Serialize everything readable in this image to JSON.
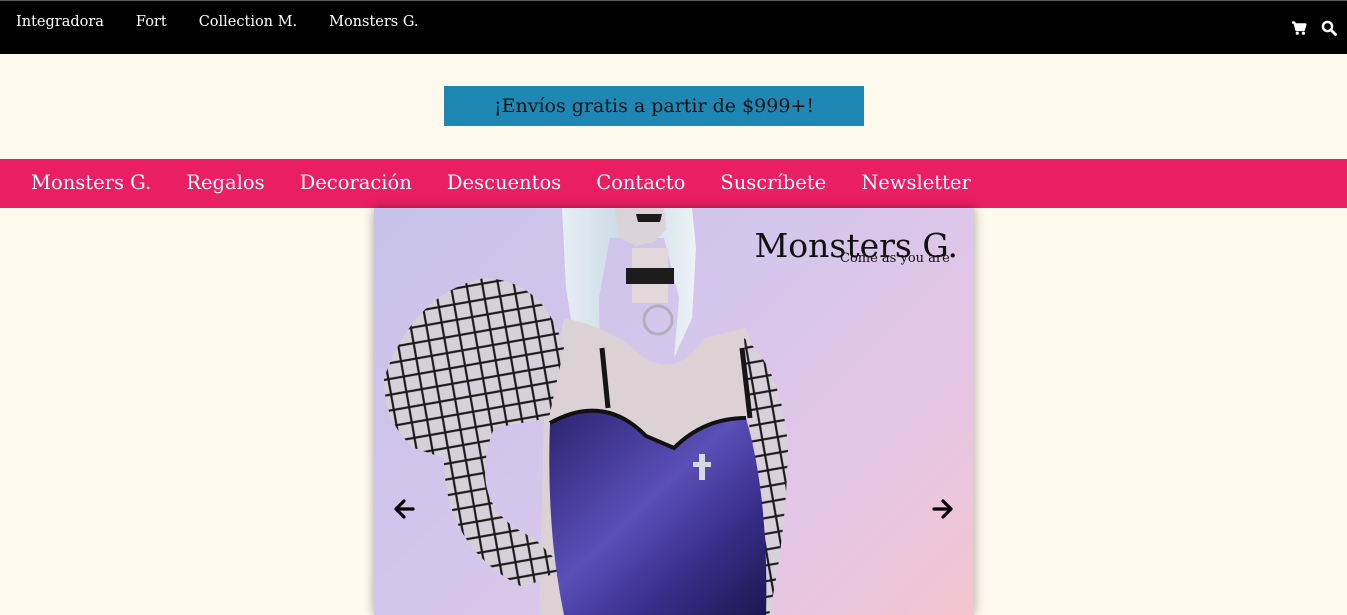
{
  "top_nav": {
    "items": [
      "Integradora",
      "Fort",
      "Collection M.",
      "Monsters G."
    ],
    "icons": [
      "shopping-cart-icon",
      "search-icon"
    ]
  },
  "promo": {
    "text": "¡Envíos gratis a partir de $999+!"
  },
  "category_nav": {
    "items": [
      "Monsters G.",
      "Regalos",
      "Decoración",
      "Descuentos",
      "Contacto",
      "Suscríbete",
      "Newsletter"
    ]
  },
  "hero": {
    "title": "Monsters G.",
    "subtitle": "Come as you are",
    "controls": [
      "arrow-left-icon",
      "arrow-right-icon"
    ]
  },
  "colors": {
    "top_bar": "#000000",
    "promo_bg": "#1f87b3",
    "category_bar": "#ea1e63",
    "page_bg": "#fff9ee"
  }
}
